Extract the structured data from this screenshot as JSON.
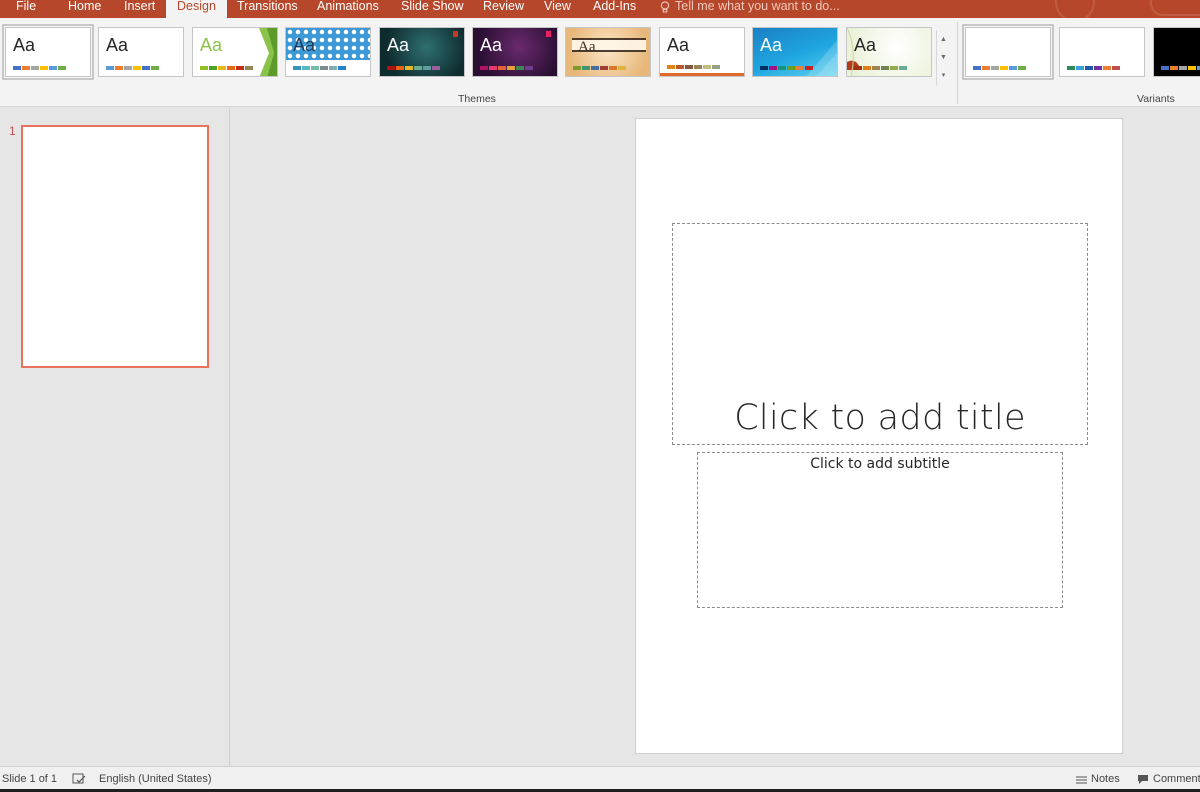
{
  "tabs": {
    "file": "File",
    "home": "Home",
    "insert": "Insert",
    "design": "Design",
    "transitions": "Transitions",
    "animations": "Animations",
    "slide_show": "Slide Show",
    "review": "Review",
    "view": "View",
    "addins": "Add-Ins",
    "tell_me": "Tell me what you want to do..."
  },
  "ribbon": {
    "themes_label": "Themes",
    "variants_label": "Variants",
    "theme_sample_text": "Aa"
  },
  "thumbnail": {
    "number": "1"
  },
  "slide": {
    "title_placeholder": "Click to add title",
    "subtitle_placeholder": "Click to add subtitle"
  },
  "status": {
    "slide_counter": "Slide 1 of 1",
    "language": "English (United States)",
    "notes": "Notes",
    "comments": "Comments"
  },
  "colors": {
    "accent": "#b7472a",
    "selection": "#e8725c"
  }
}
